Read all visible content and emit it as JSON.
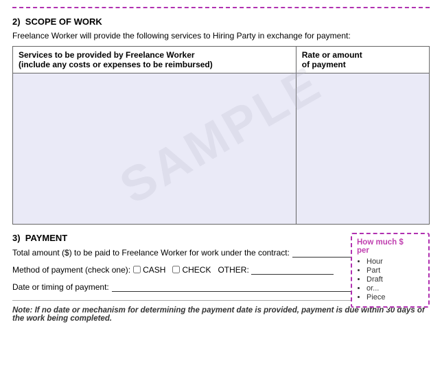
{
  "scope": {
    "section_number": "2)",
    "section_title": "SCOPE OF WORK",
    "intro_text": "Freelance Worker will provide the following services to Hiring Party in exchange for payment:",
    "table_headers": {
      "col1": "Services to be provided by Freelance Worker\n(include any costs or expenses to be reimbursed)",
      "col2": "Rate or amount\nof payment"
    },
    "watermark": "SAMPLE"
  },
  "payment": {
    "section_number": "3)",
    "section_title": "PAYMENT",
    "total_label": "Total amount ($) to be paid to Freelance Worker for work under the contract:",
    "method_label": "Method of payment (check one):",
    "cash_label": "CASH",
    "check_label": "CHECK",
    "other_label": "OTHER:",
    "date_label": "Date or timing of payment:",
    "note_bold": "Note:",
    "note_text": " If no date or mechanism for determining the payment date is provided, payment is due within 30 days of the work being completed.",
    "callout": {
      "title": "How much $\nper",
      "items": [
        "Hour",
        "Part",
        "Draft",
        "or...",
        "Piece"
      ]
    }
  }
}
